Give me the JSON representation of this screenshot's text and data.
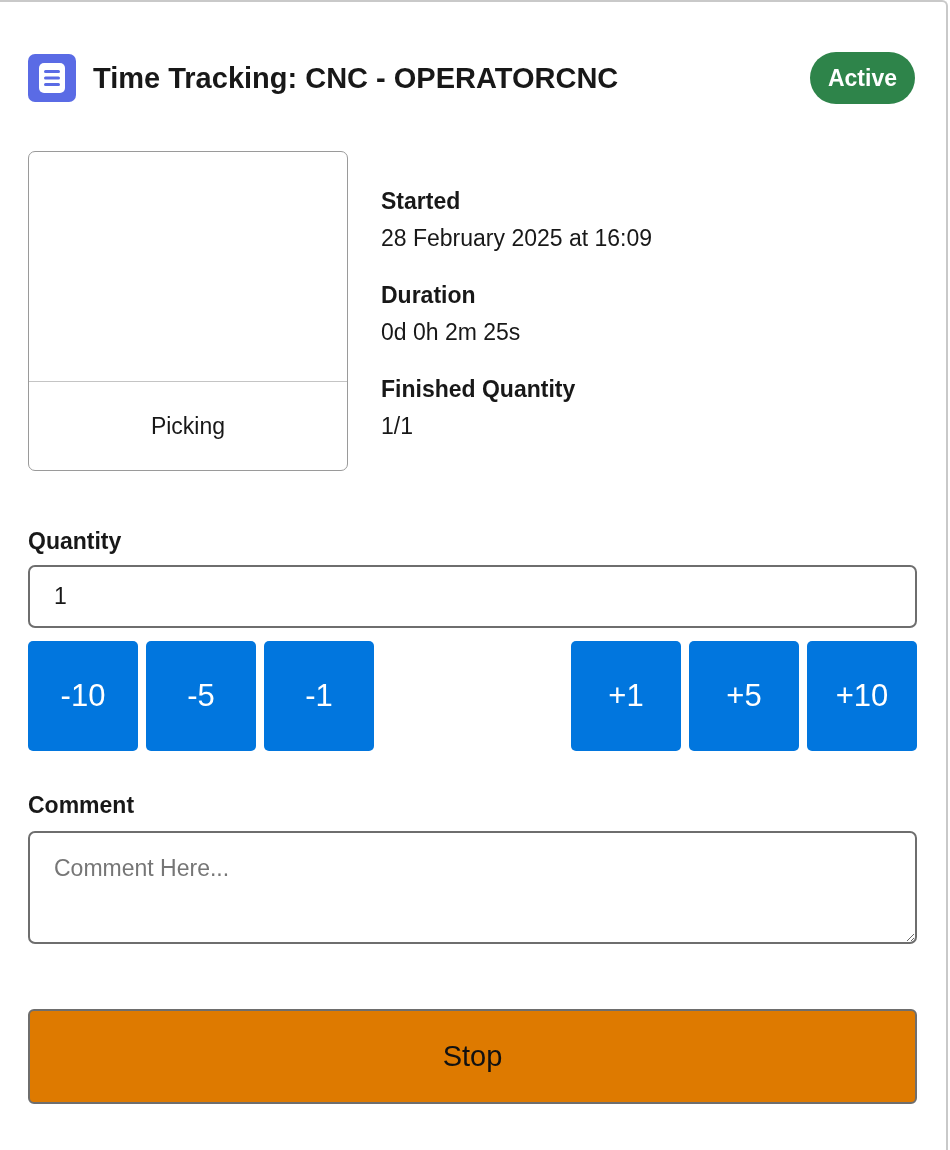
{
  "header": {
    "title": "Time Tracking: CNC - OPERATORCNC",
    "status": {
      "label": "Active",
      "kind": "active"
    }
  },
  "step": {
    "label": "Picking"
  },
  "details": [
    {
      "label": "Started",
      "value": "28 February 2025 at 16:09"
    },
    {
      "label": "Duration",
      "value": "0d 0h 2m 25s"
    },
    {
      "label": "Finished Quantity",
      "value": "1/1"
    }
  ],
  "quantity": {
    "label": "Quantity",
    "value": "1"
  },
  "adjust_buttons": [
    {
      "label": "-10",
      "kind": "decrement"
    },
    {
      "label": "-5",
      "kind": "decrement"
    },
    {
      "label": "-1",
      "kind": "decrement"
    },
    {
      "label": "+1",
      "kind": "increment"
    },
    {
      "label": "+5",
      "kind": "increment"
    },
    {
      "label": "+10",
      "kind": "increment"
    }
  ],
  "comment": {
    "label": "Comment",
    "placeholder": "Comment Here..."
  },
  "stop_button": {
    "label": "Stop"
  }
}
